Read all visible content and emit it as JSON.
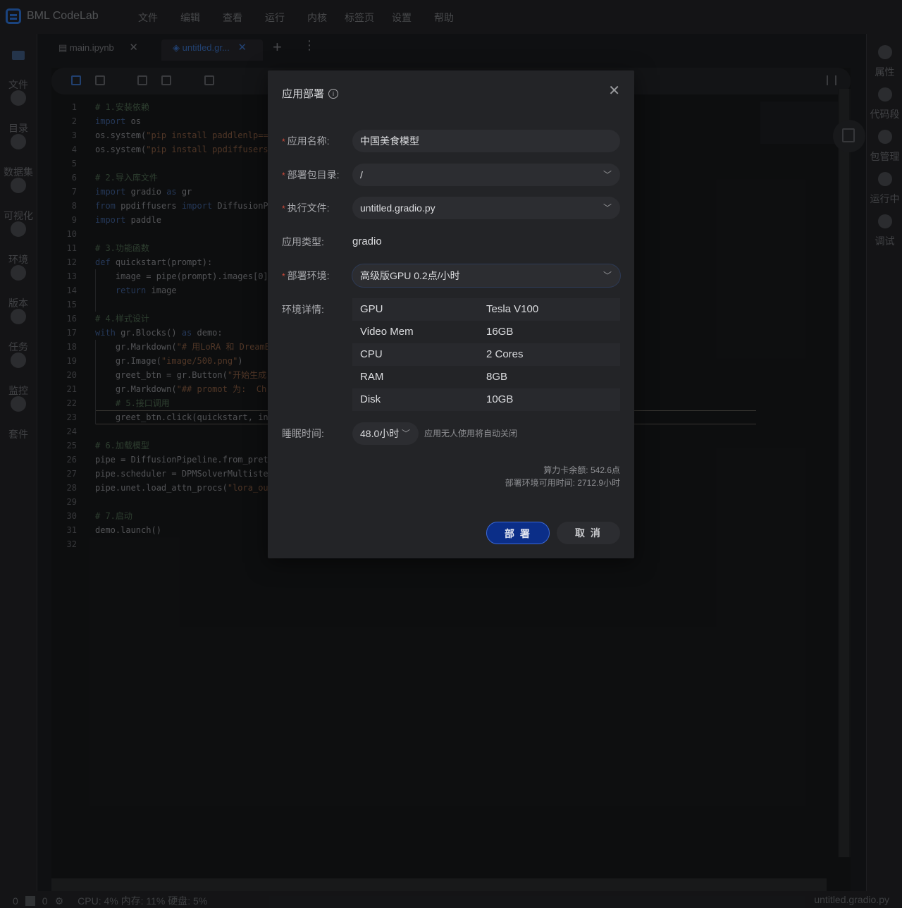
{
  "app": {
    "title": "BML CodeLab"
  },
  "menu": [
    "文件",
    "编辑",
    "查看",
    "运行",
    "内核",
    "标签页",
    "设置",
    "帮助"
  ],
  "left_sidebar": [
    {
      "label": "文件",
      "icon": "folder-icon"
    },
    {
      "label": "目录",
      "icon": "list-icon"
    },
    {
      "label": "数据集",
      "icon": "dataset-icon"
    },
    {
      "label": "可视化",
      "icon": "chart-icon"
    },
    {
      "label": "环境",
      "icon": "environment-icon"
    },
    {
      "label": "版本",
      "icon": "version-icon"
    },
    {
      "label": "任务",
      "icon": "task-icon"
    },
    {
      "label": "监控",
      "icon": "monitor-icon"
    },
    {
      "label": "套件",
      "icon": "suite-icon"
    }
  ],
  "right_sidebar": [
    {
      "label": "属性",
      "icon": "gear-icon"
    },
    {
      "label": "代码段",
      "icon": "snippet-icon"
    },
    {
      "label": "包管理",
      "icon": "package-icon"
    },
    {
      "label": "运行中",
      "icon": "play-icon"
    },
    {
      "label": "调试",
      "icon": "debug-icon"
    }
  ],
  "tabs": {
    "main": "main.ipynb",
    "active": "untitled.gr...",
    "close": "✕",
    "add": "+",
    "more": "⋮"
  },
  "code": [
    {
      "n": "1",
      "html": "<span class='cmt'># 1.安装依赖</span>"
    },
    {
      "n": "2",
      "html": "<span class='kw'>import</span> os"
    },
    {
      "n": "3",
      "html": "os.system(<span class='str'>\"pip install paddlenlp==</span>"
    },
    {
      "n": "4",
      "html": "os.system(<span class='str'>\"pip install ppdiffusers</span>"
    },
    {
      "n": "5",
      "html": ""
    },
    {
      "n": "6",
      "html": "<span class='cmt'># 2.导入库文件</span>"
    },
    {
      "n": "7",
      "html": "<span class='kw'>import</span> gradio <span class='kw'>as</span> gr"
    },
    {
      "n": "8",
      "html": "<span class='kw'>from</span> ppdiffusers <span class='kw'>import</span> DiffusionPi"
    },
    {
      "n": "9",
      "html": "<span class='kw'>import</span> paddle"
    },
    {
      "n": "10",
      "html": ""
    },
    {
      "n": "11",
      "html": "<span class='cmt'># 3.功能函数</span>"
    },
    {
      "n": "12",
      "html": "<span class='kw'>def</span> quickstart(prompt):"
    },
    {
      "n": "13",
      "html": "    image = pipe(prompt).images[0]"
    },
    {
      "n": "14",
      "html": "    <span class='kw'>return</span> image"
    },
    {
      "n": "15",
      "html": ""
    },
    {
      "n": "16",
      "html": "<span class='cmt'># 4.样式设计</span>"
    },
    {
      "n": "17",
      "html": "<span class='kw'>with</span> gr.Blocks() <span class='kw'>as</span> demo:"
    },
    {
      "n": "18",
      "html": "    gr.Markdown(<span class='str'>\"# 用LoRA 和 DreamB</span>"
    },
    {
      "n": "19",
      "html": "    gr.Image(<span class='str'>\"image/500.png\"</span>)"
    },
    {
      "n": "20",
      "html": "    greet_btn = gr.Button(<span class='str'>\"开始生成</span>"
    },
    {
      "n": "21",
      "html": "    gr.Markdown(<span class='str'>\"## promot 为:  Ch</span>"
    },
    {
      "n": "22",
      "html": "    <span class='cmt'># 5.接口调用</span>"
    },
    {
      "n": "23",
      "html": "    greet_btn.click(quickstart, in"
    },
    {
      "n": "24",
      "html": ""
    },
    {
      "n": "25",
      "html": "<span class='cmt'># 6.加载模型</span>"
    },
    {
      "n": "26",
      "html": "pipe = DiffusionPipeline.from_pretr"
    },
    {
      "n": "27",
      "html": "pipe.scheduler = DPMSolverMultistep"
    },
    {
      "n": "28",
      "html": "pipe.unet.load_attn_procs(<span class='str'>\"lora_out</span>"
    },
    {
      "n": "29",
      "html": ""
    },
    {
      "n": "30",
      "html": "<span class='cmt'># 7.启动</span>"
    },
    {
      "n": "31",
      "html": "demo.launch()"
    },
    {
      "n": "32",
      "html": ""
    }
  ],
  "status": {
    "num1": "0",
    "num2": "0",
    "resources": "CPU:  4% 内存:  11% 硬盘:  5%",
    "file": "untitled.gradio.py"
  },
  "dialog": {
    "title": "应用部署",
    "close": "✕",
    "app_name": {
      "label": "应用名称:",
      "value": "中国美食模型"
    },
    "package_dir": {
      "label": "部署包目录:",
      "value": "/"
    },
    "exec_file": {
      "label": "执行文件:",
      "value": "untitled.gradio.py"
    },
    "app_type": {
      "label": "应用类型:",
      "value": "gradio"
    },
    "env": {
      "label": "部署环境:",
      "value": "高级版GPU 0.2点/小时"
    },
    "env_details": {
      "label": "环境详情:",
      "rows": [
        {
          "k": "GPU",
          "v": "Tesla V100"
        },
        {
          "k": "Video Mem",
          "v": "16GB"
        },
        {
          "k": "CPU",
          "v": "2 Cores"
        },
        {
          "k": "RAM",
          "v": "8GB"
        },
        {
          "k": "Disk",
          "v": "10GB"
        }
      ]
    },
    "sleep": {
      "label": "睡眠时间:",
      "value": "48.0小时",
      "note": "应用无人使用将自动关闭"
    },
    "balance": "算力卡余额: 542.6点",
    "available_time": "部署环境可用时间: 2712.9小时",
    "deploy_button": "部 署",
    "cancel_button": "取 消"
  }
}
